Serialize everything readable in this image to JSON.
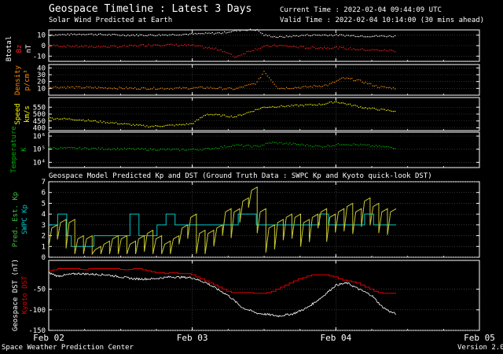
{
  "header": {
    "title": "Geospace Timeline : Latest 3 Days",
    "subtitle": "Solar Wind Predicted at Earth",
    "current_time": "Current Time : 2022-02-04 09:44:09 UTC",
    "valid_time": "Valid Time : 2022-02-04 10:14:00 (30 mins ahead)",
    "middle_title": "Geospace Model Predicted Kp and DST (Ground Truth Data : SWPC Kp and Kyoto quick-look DST)"
  },
  "footer": {
    "left": "Space Weather Prediction Center",
    "right": "Version 2.0"
  },
  "colors": {
    "btotal": "#ffffff",
    "bz": "#ff2020",
    "density": "#ff8c00",
    "speed": "#ffff00",
    "temperature": "#00b000",
    "pred_kp": "#c8c832",
    "swpc_kp": "#00c8c8",
    "kyoto_dst": "#e00000",
    "geospace_dst": "#ffffff",
    "axis": "#ffffff",
    "grid": "#555555"
  },
  "x_axis": {
    "range_days": [
      0,
      3
    ],
    "ticks": [
      {
        "day": 0,
        "label": "Feb 02"
      },
      {
        "day": 1,
        "label": "Feb 03"
      },
      {
        "day": 2,
        "label": "Feb 04"
      },
      {
        "day": 3,
        "label": "Feb 05"
      }
    ],
    "data_end_day": 2.42
  },
  "chart_data": [
    {
      "type": "line",
      "id": "magnetic",
      "ylabel": [
        "Btotal",
        "Bz",
        "nT"
      ],
      "ylim": [
        -15,
        15
      ],
      "yticks": [
        10,
        0,
        -10
      ],
      "series": [
        {
          "name": "Btotal",
          "x": [
            0,
            0.25,
            0.5,
            0.75,
            1.0,
            1.2,
            1.35,
            1.45,
            1.5,
            1.6,
            1.8,
            2.0,
            2.2,
            2.42
          ],
          "y": [
            10,
            11,
            10,
            10,
            11,
            12,
            15,
            15,
            10,
            8,
            10,
            10,
            9,
            9
          ]
        },
        {
          "name": "Bz",
          "x": [
            0,
            0.25,
            0.5,
            0.75,
            1.0,
            1.2,
            1.3,
            1.4,
            1.5,
            1.6,
            1.8,
            2.0,
            2.2,
            2.42
          ],
          "y": [
            0,
            -1,
            -1,
            1,
            0,
            -4,
            -11,
            -5,
            -1,
            0,
            -2,
            -2,
            -4,
            -5
          ]
        }
      ]
    },
    {
      "type": "scatter",
      "id": "density",
      "ylabel": [
        "Density",
        "p/cm³"
      ],
      "ylim": [
        0,
        45
      ],
      "yticks": [
        10,
        20,
        30,
        40
      ],
      "series": [
        {
          "name": "Density",
          "x": [
            0,
            0.3,
            0.6,
            0.9,
            1.1,
            1.3,
            1.45,
            1.5,
            1.6,
            1.8,
            1.95,
            2.05,
            2.15,
            2.3,
            2.42
          ],
          "y": [
            12,
            11,
            10,
            10,
            11,
            9,
            18,
            35,
            10,
            12,
            15,
            25,
            22,
            12,
            10
          ]
        }
      ]
    },
    {
      "type": "scatter",
      "id": "speed",
      "ylabel": [
        "Speed",
        "km/s"
      ],
      "ylim": [
        380,
        620
      ],
      "yticks": [
        400,
        450,
        500,
        550
      ],
      "series": [
        {
          "name": "Speed",
          "x": [
            0,
            0.2,
            0.5,
            0.7,
            0.9,
            1.0,
            1.1,
            1.3,
            1.5,
            1.7,
            1.9,
            2.0,
            2.2,
            2.42
          ],
          "y": [
            470,
            460,
            430,
            410,
            420,
            430,
            500,
            480,
            550,
            560,
            570,
            590,
            545,
            520
          ]
        }
      ]
    },
    {
      "type": "scatter",
      "id": "temperature",
      "ylabel": [
        "Temperature",
        "K"
      ],
      "yscale": "log",
      "ylim_log10": [
        3.6,
        6.3
      ],
      "yticks": [
        {
          "log10": 6,
          "label": "10⁶"
        },
        {
          "log10": 5,
          "label": "10⁵"
        },
        {
          "log10": 4,
          "label": "10⁴"
        }
      ],
      "series": [
        {
          "name": "Temperature",
          "x": [
            0,
            0.3,
            0.6,
            0.9,
            1.1,
            1.3,
            1.45,
            1.55,
            1.7,
            1.9,
            2.05,
            2.2,
            2.42
          ],
          "y_log10": [
            5.1,
            5.05,
            5.0,
            4.95,
            5.0,
            5.3,
            5.2,
            5.5,
            5.4,
            5.2,
            5.4,
            5.3,
            5.1
          ]
        }
      ]
    },
    {
      "type": "line",
      "id": "kp",
      "ylabel": [
        "Pred. Est. Kp",
        "SWPC Kp"
      ],
      "ylim": [
        0,
        7
      ],
      "yticks": [
        0,
        1,
        2,
        3,
        4,
        5,
        6,
        7
      ],
      "series": [
        {
          "name": "SWPC Kp",
          "style": "step",
          "values": [
            3,
            3,
            4,
            4,
            2,
            1,
            1,
            1,
            1,
            1,
            2,
            2,
            2,
            2,
            2,
            2,
            2,
            2,
            4,
            4,
            2,
            2,
            2,
            2,
            3,
            3,
            4,
            4,
            3,
            3,
            3,
            3,
            3,
            3,
            3,
            3,
            3,
            3,
            3,
            3,
            3,
            3,
            4,
            4,
            4,
            4,
            3,
            3,
            3,
            3,
            3,
            3,
            3,
            3,
            3,
            3,
            3,
            3,
            3,
            3,
            4,
            4,
            3,
            3,
            3,
            3,
            3,
            3,
            3,
            3,
            4,
            4,
            3,
            3,
            3,
            3,
            3
          ]
        },
        {
          "name": "Pred. Est. Kp",
          "style": "sawtooth",
          "step_day": 0.125,
          "values": [
            3,
            3.5,
            3.5,
            2,
            2,
            1,
            1.5,
            2,
            2,
            1.5,
            2,
            2.5,
            2,
            1.5,
            2,
            3,
            4,
            2.5,
            2.5,
            3,
            4.5,
            4.5,
            5.5,
            6.5,
            4.5,
            3,
            3.5,
            4,
            4,
            3.5,
            4,
            4.5,
            4,
            4.5,
            5,
            4.5,
            5.5,
            5,
            4.5,
            4.5
          ]
        }
      ]
    },
    {
      "type": "line",
      "id": "dst",
      "ylabel": [
        "Geospace DST (nT)",
        "Kyoto DST"
      ],
      "ylim": [
        -150,
        20
      ],
      "yticks": [
        -50,
        -100,
        -150
      ],
      "series": [
        {
          "name": "Kyoto DST",
          "style": "step",
          "step_day": 0.0417,
          "values": [
            -5,
            -3,
            0,
            0,
            0,
            0,
            0,
            -2,
            -3,
            0,
            0,
            0,
            0,
            0,
            0,
            0,
            -2,
            -3,
            -2,
            0,
            0,
            -3,
            -5,
            -8,
            -10,
            -10,
            -12,
            -10,
            -10,
            -12,
            -12,
            -12,
            -15,
            -20,
            -25,
            -30,
            -35,
            -40,
            -45,
            -50,
            -55,
            -58,
            -58,
            -58,
            -58,
            -58,
            -60,
            -60,
            -60,
            -58,
            -55,
            -50,
            -45,
            -40,
            -35,
            -30,
            -25,
            -22,
            -18,
            -15,
            -15,
            -15,
            -15,
            -18,
            -20,
            -25,
            -28,
            -30,
            -32,
            -35,
            -40,
            -45,
            -50,
            -55,
            -58,
            -60,
            -60,
            -60
          ]
        },
        {
          "name": "Geospace DST",
          "style": "line",
          "x": [
            0,
            0.06,
            0.2,
            0.4,
            0.6,
            0.72,
            0.85,
            1.0,
            1.1,
            1.25,
            1.35,
            1.45,
            1.6,
            1.7,
            1.8,
            1.9,
            2.0,
            2.08,
            2.15,
            2.25,
            2.32,
            2.38,
            2.42
          ],
          "y": [
            -10,
            -18,
            -12,
            -15,
            -25,
            -25,
            -20,
            -22,
            -35,
            -65,
            -95,
            -108,
            -115,
            -110,
            -95,
            -70,
            -40,
            -35,
            -48,
            -65,
            -92,
            -105,
            -110
          ]
        }
      ]
    }
  ]
}
